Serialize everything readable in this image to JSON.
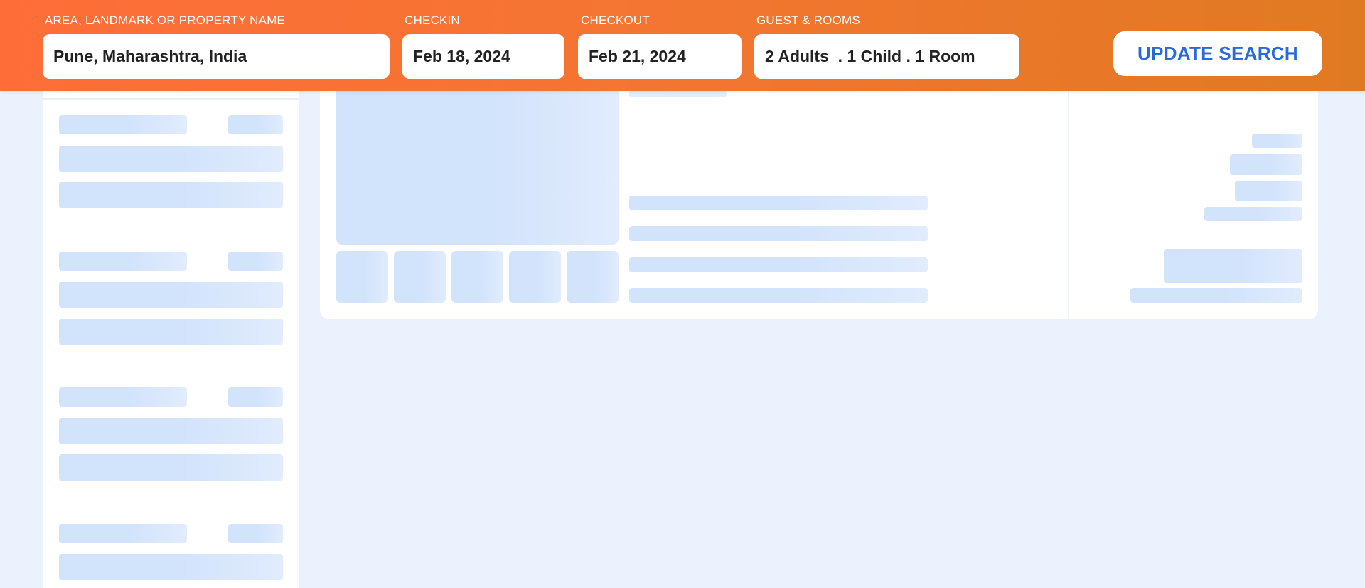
{
  "search_bar": {
    "location": {
      "label": "AREA, LANDMARK OR PROPERTY NAME",
      "value": "Pune, Maharashtra, India"
    },
    "checkin": {
      "label": "CHECKIN",
      "value": "Feb 18, 2024"
    },
    "checkout": {
      "label": "CHECKOUT",
      "value": "Feb 21, 2024"
    },
    "guests": {
      "label": "GUEST & ROOMS",
      "value": "2 Adults  . 1 Child . 1 Room"
    },
    "update_button": "UPDATE SEARCH"
  },
  "colors": {
    "header_gradient_start": "#fe6d38",
    "header_gradient_end": "#e07a22",
    "page_background": "#ebf2fd",
    "skeleton": "#d2e3fc",
    "button_text": "#2a6ad8"
  },
  "state": {
    "results_loading": true
  }
}
